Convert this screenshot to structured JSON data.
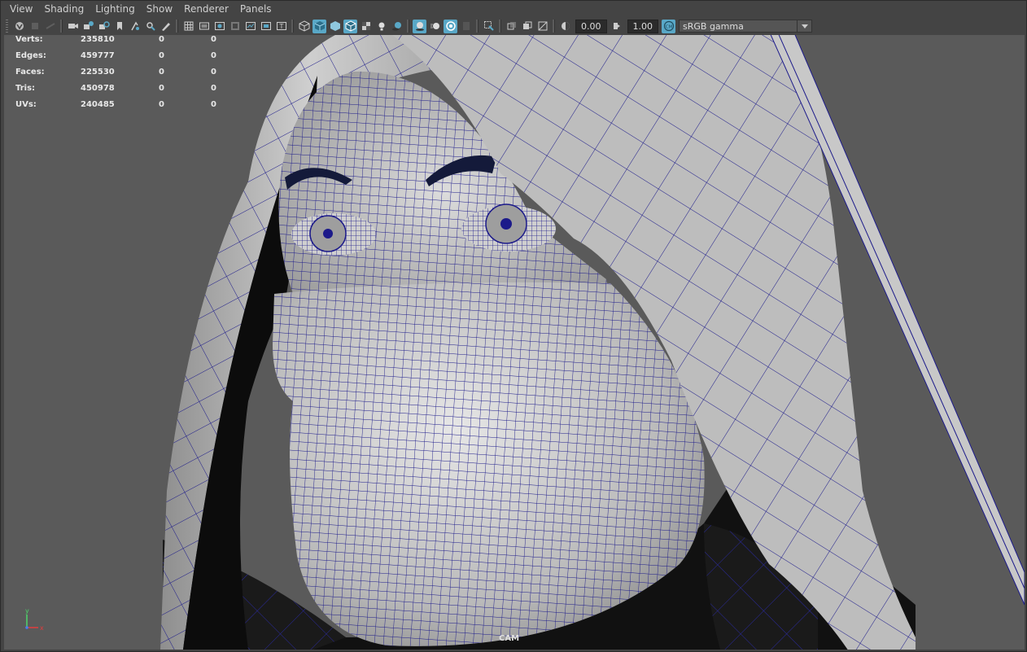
{
  "menubar": {
    "items": [
      "View",
      "Shading",
      "Lighting",
      "Show",
      "Renderer",
      "Panels"
    ]
  },
  "toolbar": {
    "exposure": "0.00",
    "gamma": "1.00",
    "color_space": "sRGB gamma",
    "icons": [
      "select-camera",
      "camera-attributes",
      "bookmark",
      "image-plane",
      "grid",
      "film-gate",
      "resolution-gate",
      "gate-mask",
      "field-chart",
      "safe-action",
      "safe-title",
      "wireframe",
      "smooth-shade",
      "wireframe-on-shaded",
      "textured",
      "use-all-lights",
      "shadows",
      "screen-space-ao",
      "motion-blur",
      "multisample-aa",
      "depth-of-field",
      "isolate-select",
      "xray",
      "xray-joints",
      "xray-active-components",
      "exposure",
      "gamma",
      "color-management"
    ],
    "accent_color": "#59a8c7"
  },
  "hud": {
    "rows": [
      {
        "label": "Verts:",
        "v1": "235810",
        "v2": "0",
        "v3": "0"
      },
      {
        "label": "Edges:",
        "v1": "459777",
        "v2": "0",
        "v3": "0"
      },
      {
        "label": "Faces:",
        "v1": "225530",
        "v2": "0",
        "v3": "0"
      },
      {
        "label": "Tris:",
        "v1": "450978",
        "v2": "0",
        "v3": "0"
      },
      {
        "label": "UVs:",
        "v1": "240485",
        "v2": "0",
        "v3": "0"
      }
    ]
  },
  "viewport": {
    "camera_label": "CAM",
    "wire_color": "#1c1a8a",
    "background_color": "#5a5a5a",
    "axis": {
      "x": "x",
      "y": "y"
    }
  }
}
